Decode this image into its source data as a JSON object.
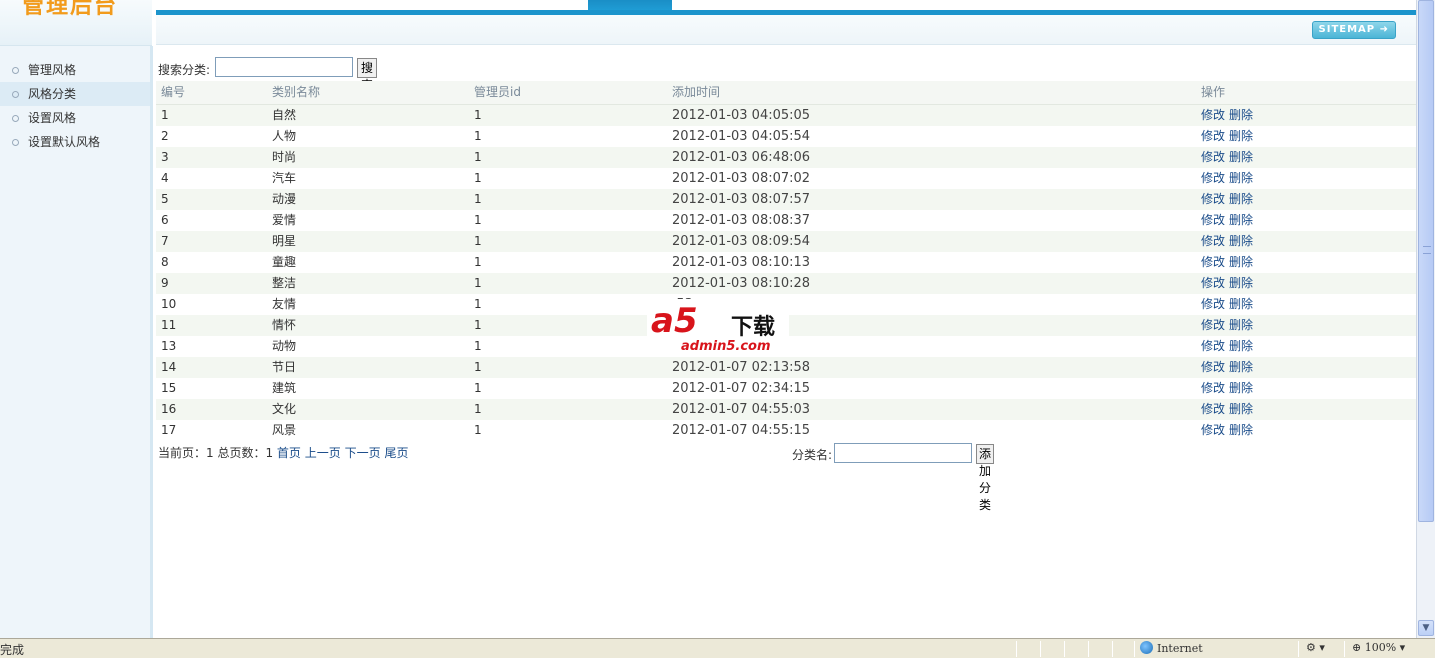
{
  "header": {
    "logo_text": "管理后台",
    "sitemap_label": "SITEMAP ➜"
  },
  "sidebar": {
    "items": [
      {
        "label": "管理风格",
        "active": false
      },
      {
        "label": "风格分类",
        "active": true
      },
      {
        "label": "设置风格",
        "active": false
      },
      {
        "label": "设置默认风格",
        "active": false
      }
    ]
  },
  "search": {
    "label": "搜索分类:",
    "value": "",
    "button": "搜索"
  },
  "table": {
    "columns": [
      "编号",
      "类别名称",
      "管理员id",
      "添加时间",
      "操作"
    ],
    "rows": [
      {
        "id": "1",
        "name": "自然",
        "admin": "1",
        "time": "2012-01-03 04:05:05"
      },
      {
        "id": "2",
        "name": "人物",
        "admin": "1",
        "time": "2012-01-03 04:05:54"
      },
      {
        "id": "3",
        "name": "时尚",
        "admin": "1",
        "time": "2012-01-03 06:48:06"
      },
      {
        "id": "4",
        "name": "汽车",
        "admin": "1",
        "time": "2012-01-03 08:07:02"
      },
      {
        "id": "5",
        "name": "动漫",
        "admin": "1",
        "time": "2012-01-03 08:07:57"
      },
      {
        "id": "6",
        "name": "爱情",
        "admin": "1",
        "time": "2012-01-03 08:08:37"
      },
      {
        "id": "7",
        "name": "明星",
        "admin": "1",
        "time": "2012-01-03 08:09:54"
      },
      {
        "id": "8",
        "name": "童趣",
        "admin": "1",
        "time": "2012-01-03 08:10:13"
      },
      {
        "id": "9",
        "name": "整洁",
        "admin": "1",
        "time": "2012-01-03 08:10:28"
      },
      {
        "id": "10",
        "name": "友情",
        "admin": "1",
        "time": ":53"
      },
      {
        "id": "11",
        "name": "情怀",
        "admin": "1",
        "time": ":58"
      },
      {
        "id": "13",
        "name": "动物",
        "admin": "1",
        "time": ":42"
      },
      {
        "id": "14",
        "name": "节日",
        "admin": "1",
        "time": "2012-01-07 02:13:58"
      },
      {
        "id": "15",
        "name": "建筑",
        "admin": "1",
        "time": "2012-01-07 02:34:15"
      },
      {
        "id": "16",
        "name": "文化",
        "admin": "1",
        "time": "2012-01-07 04:55:03"
      },
      {
        "id": "17",
        "name": "风景",
        "admin": "1",
        "time": "2012-01-07 04:55:15"
      }
    ],
    "edit_label": "修改",
    "delete_label": "删除"
  },
  "pager": {
    "text": "当前页：1 总页数：1 ",
    "first": "首页",
    "prev": "上一页",
    "next": "下一页",
    "last": "尾页"
  },
  "add_category": {
    "label": "分类名:",
    "value": "",
    "button": "添加分类"
  },
  "watermark": {
    "logo": "a5",
    "chinese": "下载",
    "url": "admin5.com"
  },
  "statusbar": {
    "status": "完成",
    "zone": "Internet",
    "zoom": "100%"
  },
  "icons": {
    "globe": "globe-icon",
    "zoom": "magnifier-icon",
    "scroll_down": "chevron-down-icon",
    "sidebar_bullet": "circle-bullet-icon"
  },
  "colors": {
    "accent": "#1c94cc",
    "logo": "#f29b1c",
    "link": "#1a4c8a",
    "row_alt": "#f3f7f1",
    "watermark_red": "#d8141b"
  }
}
